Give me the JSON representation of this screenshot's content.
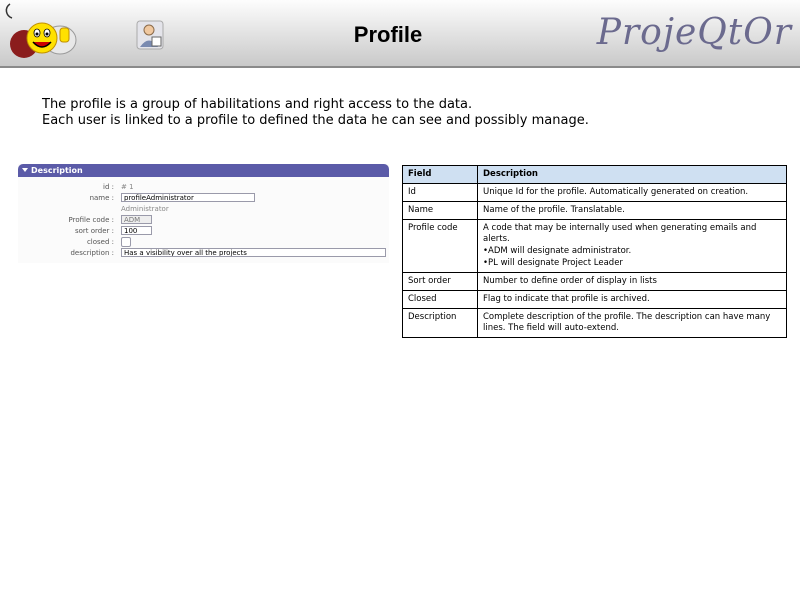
{
  "header": {
    "title": "Profile",
    "brand": "ProjeQtOr",
    "colors": {
      "header_top": "#fdfdfd",
      "header_bottom": "#c9c9c9",
      "brand": "#6b6a8e"
    }
  },
  "intro": {
    "line1": "The profile is a group of habilitations and right access to the data.",
    "line2": "Each user is linked to a profile to defined the data he can see and possibly manage."
  },
  "form": {
    "section_title": "Description",
    "section_color": "#5b5ba8",
    "id": {
      "label": "id :",
      "value": "# 1"
    },
    "name": {
      "label": "name :",
      "value": "profileAdministrator",
      "translated": "Administrator"
    },
    "profile_code": {
      "label": "Profile code :",
      "value": "ADM"
    },
    "sort_order": {
      "label": "sort order :",
      "value": "100"
    },
    "closed": {
      "label": "closed :",
      "checked": false
    },
    "description": {
      "label": "description :",
      "value": "Has a visibility over all the projects"
    }
  },
  "table": {
    "header_color": "#cfe0f2",
    "headers": {
      "field": "Field",
      "description": "Description"
    },
    "rows": [
      {
        "field": "Id",
        "description": "Unique Id for the profile. Automatically generated on creation."
      },
      {
        "field": "Name",
        "description": "Name of the profile. Translatable."
      },
      {
        "field": "Profile code",
        "description": "A code that may be internally used when generating emails and alerts.",
        "bullet1": "•ADM will designate administrator.",
        "bullet2": "•PL will designate Project Leader"
      },
      {
        "field": "Sort order",
        "description": "Number to define order of display in lists"
      },
      {
        "field": "Closed",
        "description": "Flag to indicate that  profile is archived."
      },
      {
        "field": "Description",
        "description": "Complete description of the profile. The description can have many lines. The field will auto-extend."
      }
    ]
  }
}
